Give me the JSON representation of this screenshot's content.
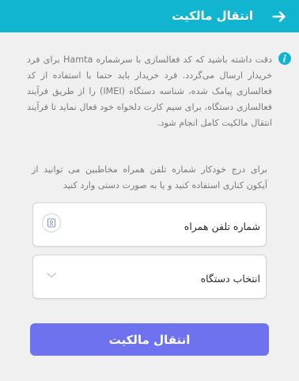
{
  "header": {
    "title": "انتقال مالکیت",
    "back_icon": "arrow-right-icon",
    "background": "#12b5cf"
  },
  "info": {
    "icon": "info-icon",
    "icon_color": "#12b5cf",
    "text": "دقت داشته باشید که کد فعالسازی با سرشماره Hamta برای فرد خریدار ارسال می‌گردد. فرد خریدار باید حتما با استفاده از کد فعالسازی پیامک شده، شناسه دستگاه (IMEI) را از طریق فرآیند فعالسازی دستگاه، برای سیم کارت دلخواه خود فعال نماید تا فرآیند انتقال مالکیت کامل انجام شود."
  },
  "instructions": {
    "text": "برای درج خودکار شماره تلفن همراه مخاطبین می توانید از آیکون کناری استفاده کنید و یا به صورت دستی وارد کنید"
  },
  "phone_field": {
    "label": "شماره تلفن همراه",
    "contact_icon": "contact-book-icon"
  },
  "device_field": {
    "label": "انتخاب دستگاه",
    "dropdown_icon": "chevron-down-icon"
  },
  "submit": {
    "label": "انتقال مالکیت",
    "color": "#6f72ee"
  }
}
